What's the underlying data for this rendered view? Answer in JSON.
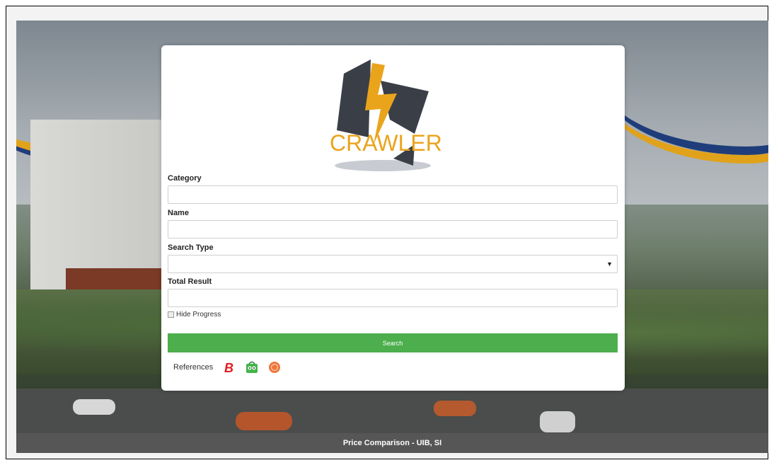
{
  "logo_text": "CRAWLER",
  "form": {
    "category": {
      "label": "Category",
      "value": ""
    },
    "name": {
      "label": "Name",
      "value": ""
    },
    "search_type": {
      "label": "Search Type",
      "value": ""
    },
    "total_result": {
      "label": "Total Result",
      "value": ""
    },
    "hide_progress_label": "Hide Progress",
    "search_button": "Search"
  },
  "references": {
    "label": "References",
    "icons": [
      "bukalapak-icon",
      "tokopedia-icon",
      "shopee-icon"
    ]
  },
  "footer": "Price Comparison - UIB, SI",
  "colors": {
    "accent_green": "#4cae4c",
    "logo_orange": "#eaa41c",
    "logo_dark": "#3a3f47"
  }
}
